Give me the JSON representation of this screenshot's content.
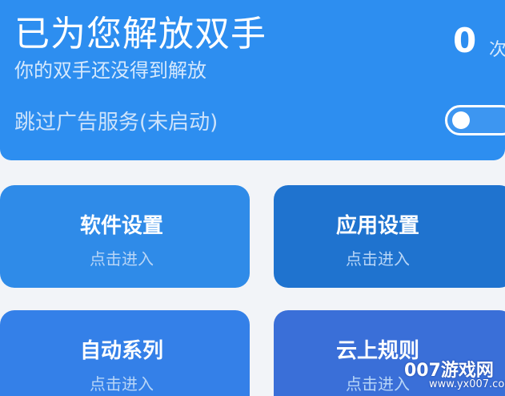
{
  "header": {
    "title": "已为您解放双手",
    "subtitle": "你的双手还没得到解放",
    "count_value": "0",
    "count_unit": "次",
    "ad_service_label": "跳过广告服务(未启动)",
    "ad_service_enabled": false
  },
  "tiles": [
    {
      "title": "软件设置",
      "subtitle": "点击进入"
    },
    {
      "title": "应用设置",
      "subtitle": "点击进入"
    },
    {
      "title": "自动系列",
      "subtitle": "点击进入"
    },
    {
      "title": "云上规则",
      "subtitle": "点击进入"
    }
  ],
  "watermark": {
    "text": "007游戏网",
    "url": "www.yx007.com"
  },
  "colors": {
    "header_bg": "#2d8ef0",
    "tile_1": "#2f8be8",
    "tile_2": "#1f73cf",
    "tile_3": "#3480e8",
    "tile_4": "#3a6fd8"
  }
}
